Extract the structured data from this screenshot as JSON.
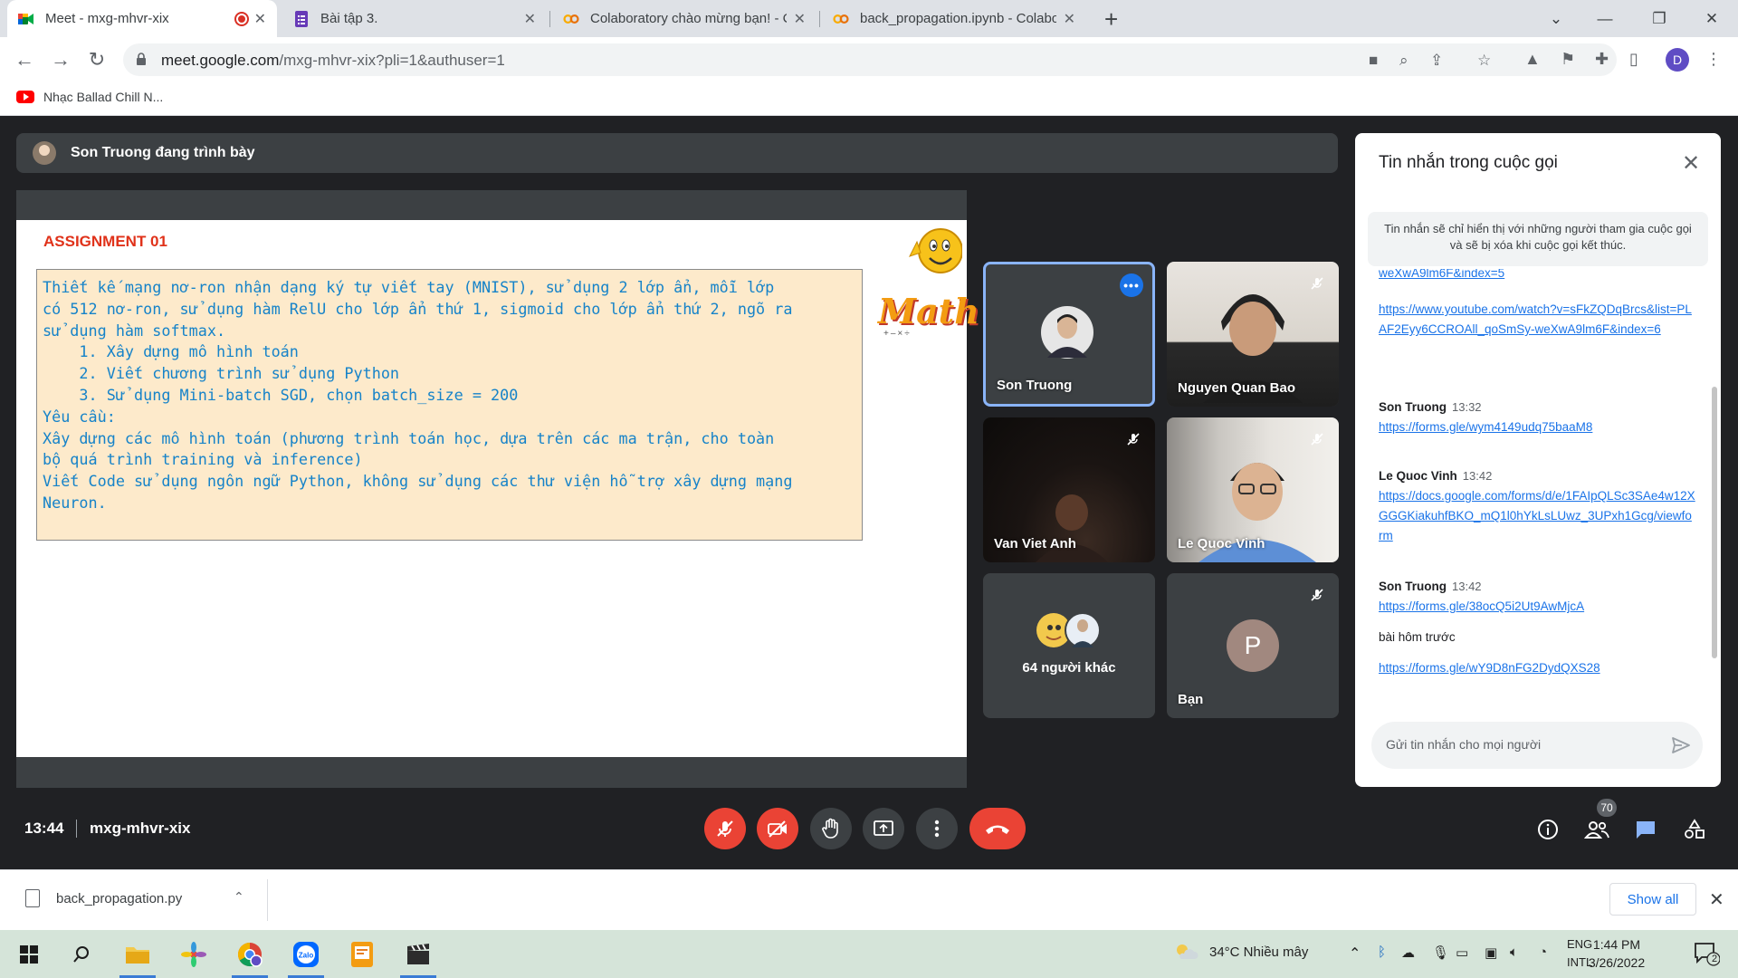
{
  "browser": {
    "tabs": [
      {
        "title": "Meet - mxg-mhvr-xix",
        "active": true
      },
      {
        "title": "Bài tập 3.",
        "active": false
      },
      {
        "title": "Colaboratory chào mừng bạn! - C",
        "active": false
      },
      {
        "title": "back_propagation.ipynb - Colabo",
        "active": false
      }
    ],
    "url_host": "meet.google.com",
    "url_path": "/mxg-mhvr-xix?pli=1&authuser=1",
    "profile_initial": "D",
    "bookmark": "Nhạc Ballad Chill N..."
  },
  "meet": {
    "presenter_text": "Son Truong đang trình bày",
    "slide": {
      "title": "ASSIGNMENT 01",
      "lines": [
        "Thiết kế mạng nơ-ron nhận dạng ký tự viết tay (MNIST), sử dụng 2 lớp ẩn, mỗi lớp",
        "có 512 nơ-ron, sử dụng hàm RelU cho lớp ẩn thứ 1, sigmoid cho lớp ẩn thứ 2, ngõ ra",
        "sử dụng hàm softmax.",
        "    1. Xây dựng mô hình toán",
        "    2. Viết chương trình sử dụng Python",
        "    3. Sử dụng Mini-batch SGD, chọn batch_size = 200",
        "Yêu cầu:",
        "Xây dựng các mô hình toán (phương trình toán học, dựa trên các ma trận, cho toàn",
        "bộ quá trình training và inference)",
        "Viết Code sử dụng ngôn ngữ Python, không sử dụng các thư viện hỗ trợ xây dựng mạng",
        "Neuron."
      ],
      "logo_text": "Math"
    },
    "tiles": [
      {
        "name": "Son Truong"
      },
      {
        "name": "Nguyen Quan Bao"
      },
      {
        "name": "Van Viet Anh"
      },
      {
        "name": "Le Quoc Vinh"
      },
      {
        "name": "64 người khác"
      },
      {
        "name": "Bạn",
        "initial": "P"
      }
    ],
    "chat": {
      "title": "Tin nhắn trong cuộc gọi",
      "notice": "Tin nhắn sẽ chỉ hiển thị với những người tham gia cuộc gọi và sẽ bị xóa khi cuộc gọi kết thúc.",
      "messages": [
        {
          "link": "weXwA9lm6F&index=5"
        },
        {
          "link": "https://www.youtube.com/watch?v=sFkZQDqBrcs&list=PLAF2Eyy6CCROAll_qoSmSy-weXwA9lm6F&index=6"
        },
        {
          "sender": "Son Truong",
          "time": "13:32",
          "link": "https://forms.gle/wym4149udq75baaM8"
        },
        {
          "sender": "Le Quoc Vinh",
          "time": "13:42",
          "link": "https://docs.google.com/forms/d/e/1FAIpQLSc3SAe4w12XGGGKiakuhfBKO_mQ1l0hYkLsLUwz_3UPxh1Gcg/viewform"
        },
        {
          "sender": "Son Truong",
          "time": "13:42",
          "link": "https://forms.gle/38ocQ5i2Ut9AwMjcA"
        },
        {
          "text": "bài hôm trước"
        },
        {
          "link": "https://forms.gle/wY9D8nFG2DydQXS28"
        }
      ],
      "input_placeholder": "Gửi tin nhắn cho mọi người"
    },
    "bottom": {
      "time": "13:44",
      "meeting_code": "mxg-mhvr-xix",
      "participant_count": "70"
    }
  },
  "downloads": {
    "file": "back_propagation.py",
    "show_all": "Show all"
  },
  "taskbar": {
    "weather": "34°C  Nhiều mây",
    "lang_1": "ENG",
    "lang_2": "INTL",
    "time": "1:44 PM",
    "date": "3/26/2022",
    "notifications": "2"
  },
  "colors": {
    "meet_bg": "#202124",
    "tile_bg": "#3c4043",
    "danger": "#ea4335",
    "accent": "#1a73e8",
    "slide_text": "#1683c9",
    "slide_title": "#e0321a"
  }
}
